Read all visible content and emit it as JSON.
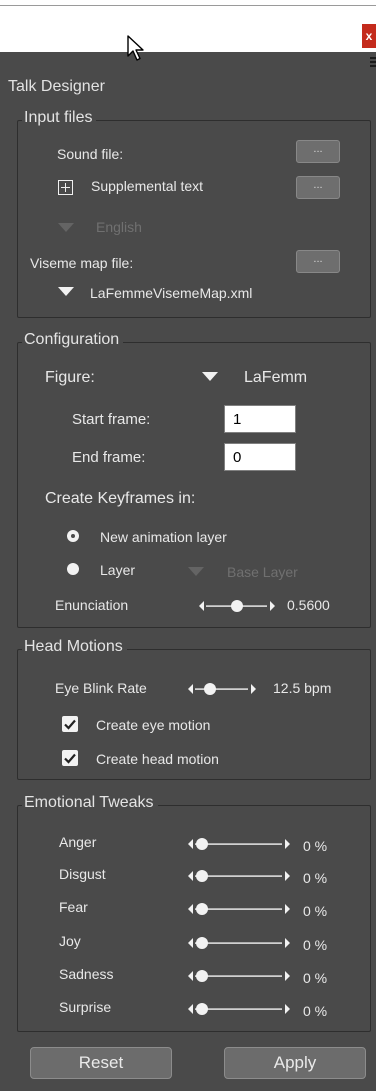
{
  "window": {
    "close_label": "x"
  },
  "app": {
    "title": "Talk Designer"
  },
  "input_files": {
    "legend": "Input files",
    "sound_file_label": "Sound file:",
    "supplemental_text_label": "Supplemental text",
    "language_label": "English",
    "viseme_map_label": "Viseme map file:",
    "viseme_map_value": "LaFemmeVisemeMap.xml",
    "browse_label": "..."
  },
  "configuration": {
    "legend": "Configuration",
    "figure_label": "Figure:",
    "figure_value": "LaFemm",
    "start_frame_label": "Start frame:",
    "start_frame_value": "1",
    "end_frame_label": "End frame:",
    "end_frame_value": "0",
    "create_keyframes_label": "Create Keyframes in:",
    "new_layer_label": "New animation layer",
    "layer_label": "Layer",
    "base_layer_label": "Base Layer",
    "enunciation_label": "Enunciation",
    "enunciation_value": "0.5600",
    "enunciation_fraction": 0.56
  },
  "head_motions": {
    "legend": "Head Motions",
    "eye_blink_label": "Eye Blink Rate",
    "eye_blink_value": "12.5 bpm",
    "eye_motion_label": "Create eye motion",
    "head_motion_label": "Create head motion"
  },
  "emotional_tweaks": {
    "legend": "Emotional Tweaks",
    "items": [
      {
        "label": "Anger",
        "value": "0 %"
      },
      {
        "label": "Disgust",
        "value": "0 %"
      },
      {
        "label": "Fear",
        "value": "0 %"
      },
      {
        "label": "Joy",
        "value": "0 %"
      },
      {
        "label": "Sadness",
        "value": "0 %"
      },
      {
        "label": "Surprise",
        "value": "0 %"
      }
    ]
  },
  "footer": {
    "reset_label": "Reset",
    "apply_label": "Apply"
  },
  "colors": {
    "panel": "#4a4a4a",
    "close_button": "#c42b1c",
    "field": "#ffffff"
  }
}
